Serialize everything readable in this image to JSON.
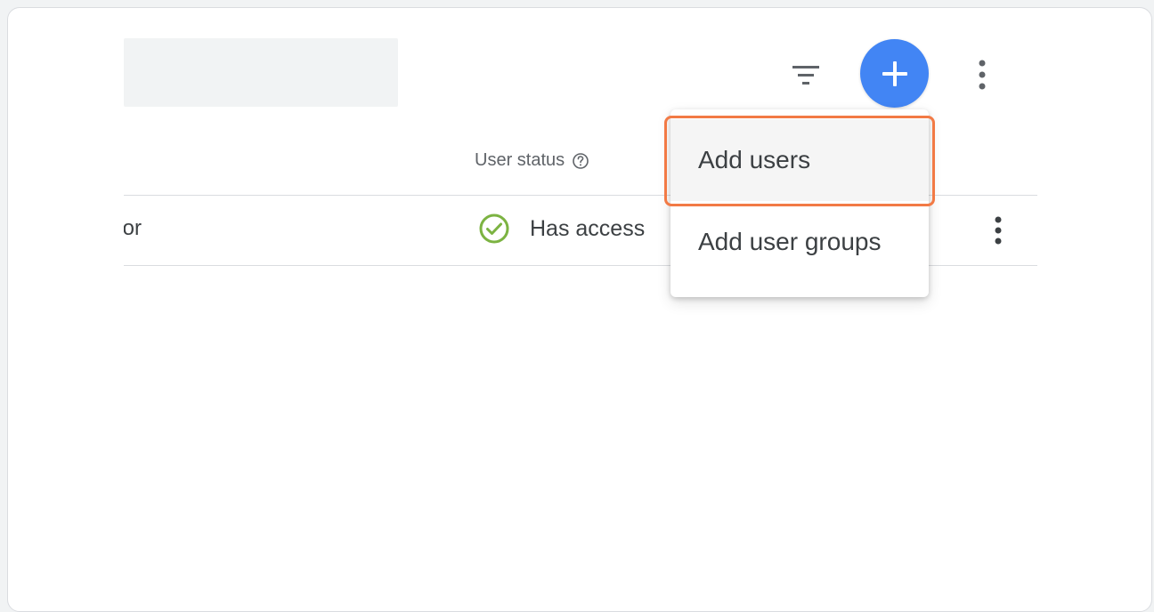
{
  "toolbar": {
    "filter_icon": "filter-icon",
    "add_icon": "plus-icon",
    "more_icon": "more-vert-icon",
    "add_button_color": "#4285f4"
  },
  "table": {
    "columns": {
      "user_status": "User status",
      "help_icon": "help-circle-icon"
    },
    "rows": [
      {
        "role_fragment": "or",
        "status": "Has access",
        "status_icon": "check-circle-icon",
        "status_color": "#7cb342"
      }
    ]
  },
  "add_menu": {
    "items": [
      {
        "label": "Add users"
      },
      {
        "label": "Add user groups"
      }
    ],
    "highlight_color": "#f27a45"
  }
}
